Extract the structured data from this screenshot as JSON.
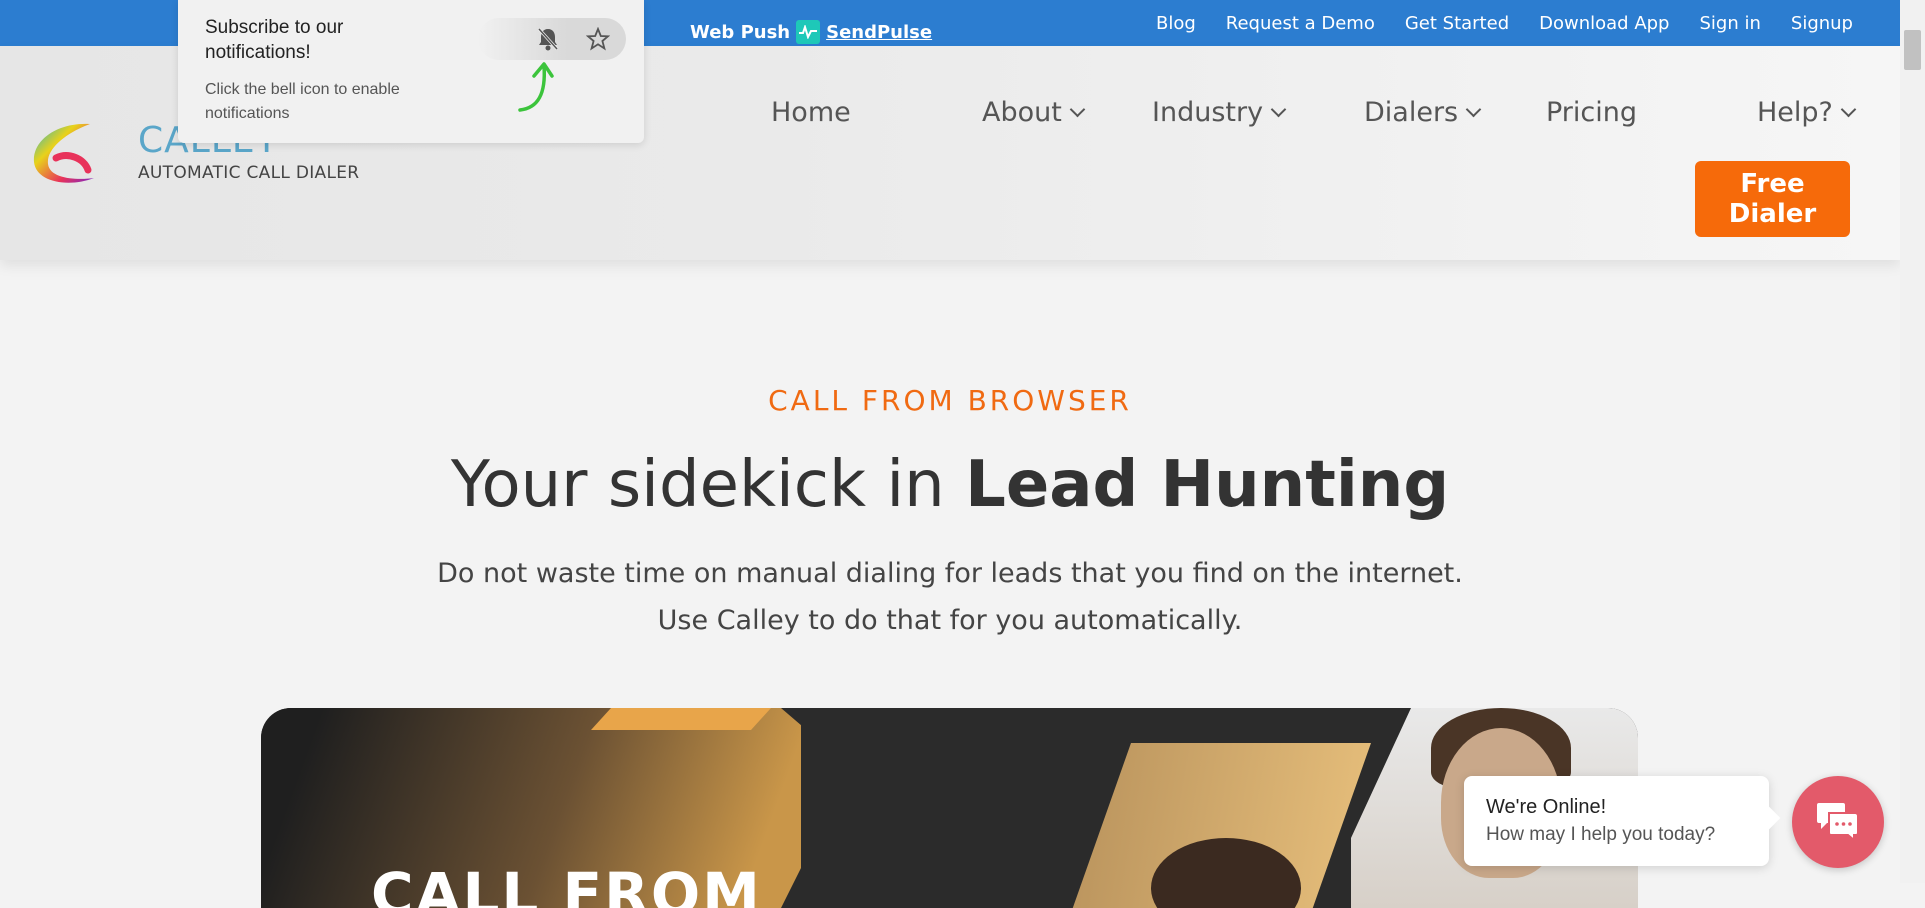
{
  "webpush": {
    "label": "Web Push",
    "brand": "SendPulse"
  },
  "topnav": [
    "Blog",
    "Request a Demo",
    "Get Started",
    "Download App",
    "Sign in",
    "Signup"
  ],
  "popup": {
    "title": "Subscribe to our notifications!",
    "description": "Click the bell icon to enable notifications",
    "icons": [
      "bell-muted-icon",
      "star-icon",
      "arrow-icon"
    ]
  },
  "header": {
    "brand_name": "CALLEY",
    "tagline": "AUTOMATIC CALL DIALER",
    "nav": [
      {
        "label": "Home",
        "dropdown": false
      },
      {
        "label": "About",
        "dropdown": true
      },
      {
        "label": "Industry",
        "dropdown": true
      },
      {
        "label": "Dialers",
        "dropdown": true
      },
      {
        "label": "Pricing",
        "dropdown": false
      },
      {
        "label": "Help?",
        "dropdown": true
      }
    ],
    "cta": "Free Dialer"
  },
  "hero": {
    "kicker": "CALL FROM BROWSER",
    "headline_plain": "Your sidekick in ",
    "headline_bold": "Lead Hunting",
    "sub_line1": "Do not waste time on manual dialing for leads that you find on the internet.",
    "sub_line2": "Use Calley to do that for you automatically.",
    "banner_text": "CALL FROM"
  },
  "chat": {
    "line1": "We're Online!",
    "line2": "How may I help you today?"
  },
  "colors": {
    "topbar": "#2c7dd0",
    "accent": "#f66a0a",
    "chat": "#e35a6a"
  }
}
